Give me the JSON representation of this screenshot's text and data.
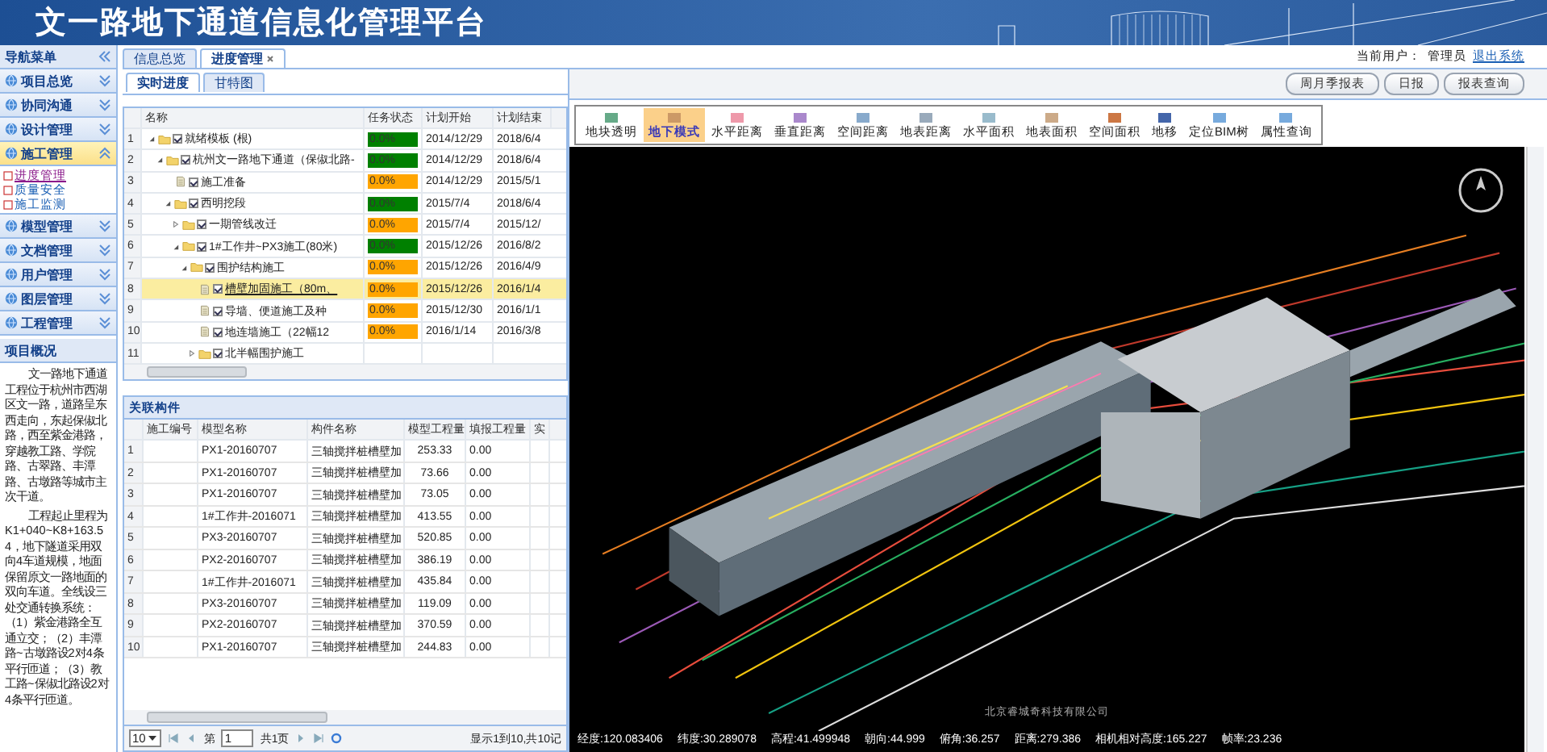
{
  "header": {
    "title": "文一路地下通道信息化管理平台"
  },
  "user": {
    "label": "当前用户：",
    "name": "管理员",
    "logout": "退出系统"
  },
  "nav": {
    "title": "导航菜单",
    "items": [
      {
        "label": "项目总览",
        "expanded": false,
        "selected": false
      },
      {
        "label": "协同沟通",
        "expanded": false,
        "selected": false
      },
      {
        "label": "设计管理",
        "expanded": false,
        "selected": false
      },
      {
        "label": "施工管理",
        "expanded": true,
        "selected": true,
        "children": [
          {
            "label": "进度管理",
            "selected": true
          },
          {
            "label": "质量安全",
            "selected": false
          },
          {
            "label": "施工监测",
            "selected": false
          }
        ]
      },
      {
        "label": "模型管理",
        "expanded": false,
        "selected": false
      },
      {
        "label": "文档管理",
        "expanded": false,
        "selected": false
      },
      {
        "label": "用户管理",
        "expanded": false,
        "selected": false
      },
      {
        "label": "图层管理",
        "expanded": false,
        "selected": false
      },
      {
        "label": "工程管理",
        "expanded": false,
        "selected": false
      }
    ]
  },
  "overview": {
    "title": "项目概况",
    "paragraphs": [
      "文一路地下通道工程位于杭州市西湖区文一路，道路呈东西走向，东起保俶北路，西至紫金港路，穿越教工路、学院路、古翠路、丰潭路、古墩路等城市主次干道。",
      "工程起止里程为K1+040~K8+163.54，地下隧道采用双向4车道规模，地面保留原文一路地面的双向车道。全线设三处交通转换系统：（1）紫金港路全互通立交；（2）丰潭路~古墩路设2对4条平行匝道；（3）教工路~保俶北路设2对4条平行匝道。"
    ]
  },
  "tabs": [
    {
      "label": "信息总览",
      "selected": false,
      "closable": false
    },
    {
      "label": "进度管理",
      "selected": true,
      "closable": true
    }
  ],
  "subtabs": [
    {
      "label": "实时进度",
      "selected": true
    },
    {
      "label": "甘特图",
      "selected": false
    }
  ],
  "tree": {
    "columns": [
      "名称",
      "任务状态",
      "计划开始",
      "计划结束"
    ],
    "rows": [
      {
        "number": "1",
        "name": "就绪模板 (根)",
        "kind": "folder",
        "expanded": true,
        "checked": true,
        "status": "0.0%",
        "color": "#008000",
        "start": "2014/12/29",
        "end": "2018/6/4",
        "selected": false,
        "children": [
          {
            "number": "2",
            "name": "杭州文一路地下通道（保俶北路-",
            "kind": "folder",
            "expanded": true,
            "checked": true,
            "status": "0.0%",
            "color": "#008000",
            "start": "2014/12/29",
            "end": "2018/6/4",
            "selected": false,
            "children": [
              {
                "number": "3",
                "name": "施工准备",
                "kind": "file",
                "checked": true,
                "status": "0.0%",
                "color": "#ffa500",
                "start": "2014/12/29",
                "end": "2015/5/1",
                "selected": false
              },
              {
                "number": "4",
                "name": "西明挖段",
                "kind": "folder",
                "expanded": true,
                "checked": true,
                "status": "0.0%",
                "color": "#008000",
                "start": "2015/7/4",
                "end": "2018/6/4",
                "selected": false,
                "children": [
                  {
                    "number": "5",
                    "name": "一期管线改迁",
                    "kind": "folder",
                    "expanded": false,
                    "checked": true,
                    "status": "0.0%",
                    "color": "#ffa500",
                    "start": "2015/7/4",
                    "end": "2015/12/",
                    "selected": false
                  },
                  {
                    "number": "6",
                    "name": "1#工作井~PX3施工(80米)",
                    "kind": "folder",
                    "expanded": true,
                    "checked": true,
                    "status": "0.0%",
                    "color": "#008000",
                    "start": "2015/12/26",
                    "end": "2016/8/2",
                    "selected": false,
                    "children": [
                      {
                        "number": "7",
                        "name": "围护结构施工",
                        "kind": "folder",
                        "expanded": true,
                        "checked": true,
                        "status": "0.0%",
                        "color": "#ffa500",
                        "start": "2015/12/26",
                        "end": "2016/4/9",
                        "selected": false,
                        "children": [
                          {
                            "number": "8",
                            "name": "槽壁加固施工（80m、",
                            "kind": "file",
                            "checked": true,
                            "status": "0.0%",
                            "color": "#ffa500",
                            "start": "2015/12/26",
                            "end": "2016/1/4",
                            "selected": true
                          },
                          {
                            "number": "9",
                            "name": "导墙、便道施工及种",
                            "kind": "file",
                            "checked": true,
                            "status": "0.0%",
                            "color": "#ffa500",
                            "start": "2015/12/30",
                            "end": "2016/1/1",
                            "selected": false
                          },
                          {
                            "number": "10",
                            "name": "地连墙施工（22幅12",
                            "kind": "file",
                            "checked": true,
                            "status": "0.0%",
                            "color": "#ffa500",
                            "start": "2016/1/14",
                            "end": "2016/3/8",
                            "selected": false
                          },
                          {
                            "number": "11",
                            "name": "北半幅围护施工",
                            "kind": "folder",
                            "expanded": false,
                            "checked": true,
                            "selected": false
                          }
                        ]
                      }
                    ]
                  }
                ]
              }
            ]
          }
        ]
      }
    ]
  },
  "parts": {
    "title": "关联构件",
    "columns": [
      "施工编号",
      "模型名称",
      "构件名称",
      "模型工程量",
      "填报工程量",
      "实"
    ],
    "rows": [
      {
        "number": "1",
        "cells": [
          "",
          "PX1-20160707",
          "三轴搅拌桩槽壁加",
          "253.33",
          "0.00"
        ]
      },
      {
        "number": "2",
        "cells": [
          "",
          "PX1-20160707",
          "三轴搅拌桩槽壁加",
          "73.66",
          "0.00"
        ]
      },
      {
        "number": "3",
        "cells": [
          "",
          "PX1-20160707",
          "三轴搅拌桩槽壁加",
          "73.05",
          "0.00"
        ]
      },
      {
        "number": "4",
        "cells": [
          "",
          "1#工作井-2016071",
          "三轴搅拌桩槽壁加",
          "413.55",
          "0.00"
        ]
      },
      {
        "number": "5",
        "cells": [
          "",
          "PX3-20160707",
          "三轴搅拌桩槽壁加",
          "520.85",
          "0.00"
        ]
      },
      {
        "number": "6",
        "cells": [
          "",
          "PX2-20160707",
          "三轴搅拌桩槽壁加",
          "386.19",
          "0.00"
        ]
      },
      {
        "number": "7",
        "cells": [
          "",
          "1#工作井-2016071",
          "三轴搅拌桩槽壁加",
          "435.84",
          "0.00"
        ]
      },
      {
        "number": "8",
        "cells": [
          "",
          "PX3-20160707",
          "三轴搅拌桩槽壁加",
          "119.09",
          "0.00"
        ]
      },
      {
        "number": "9",
        "cells": [
          "",
          "PX2-20160707",
          "三轴搅拌桩槽壁加",
          "370.59",
          "0.00"
        ]
      },
      {
        "number": "10",
        "cells": [
          "",
          "PX1-20160707",
          "三轴搅拌桩槽壁加",
          "244.83",
          "0.00"
        ]
      }
    ],
    "pager": {
      "page_size": "10",
      "page_label": "第",
      "page": "1",
      "total": "共1页",
      "summary": "显示1到10,共10记"
    }
  },
  "report_buttons": [
    "周月季报表",
    "日报",
    "报表查询"
  ],
  "toolbar": [
    {
      "label": "地块透明",
      "selected": false
    },
    {
      "label": "地下模式",
      "selected": true
    },
    {
      "label": "水平距离",
      "selected": false
    },
    {
      "label": "垂直距离",
      "selected": false
    },
    {
      "label": "空间距离",
      "selected": false
    },
    {
      "label": "地表距离",
      "selected": false
    },
    {
      "label": "水平面积",
      "selected": false
    },
    {
      "label": "地表面积",
      "selected": false
    },
    {
      "label": "空间面积",
      "selected": false
    },
    {
      "label": "地移",
      "selected": false
    },
    {
      "label": "定位BIM树",
      "selected": false
    },
    {
      "label": "属性查询",
      "selected": false
    }
  ],
  "viewer": {
    "caption": "北京睿城奇科技有限公司",
    "status": [
      "经度:120.083406",
      "纬度:30.289078",
      "高程:41.499948",
      "朝向:44.999",
      "俯角:36.257",
      "距离:279.386",
      "相机相对高度:165.227",
      "帧率:23.236"
    ]
  }
}
